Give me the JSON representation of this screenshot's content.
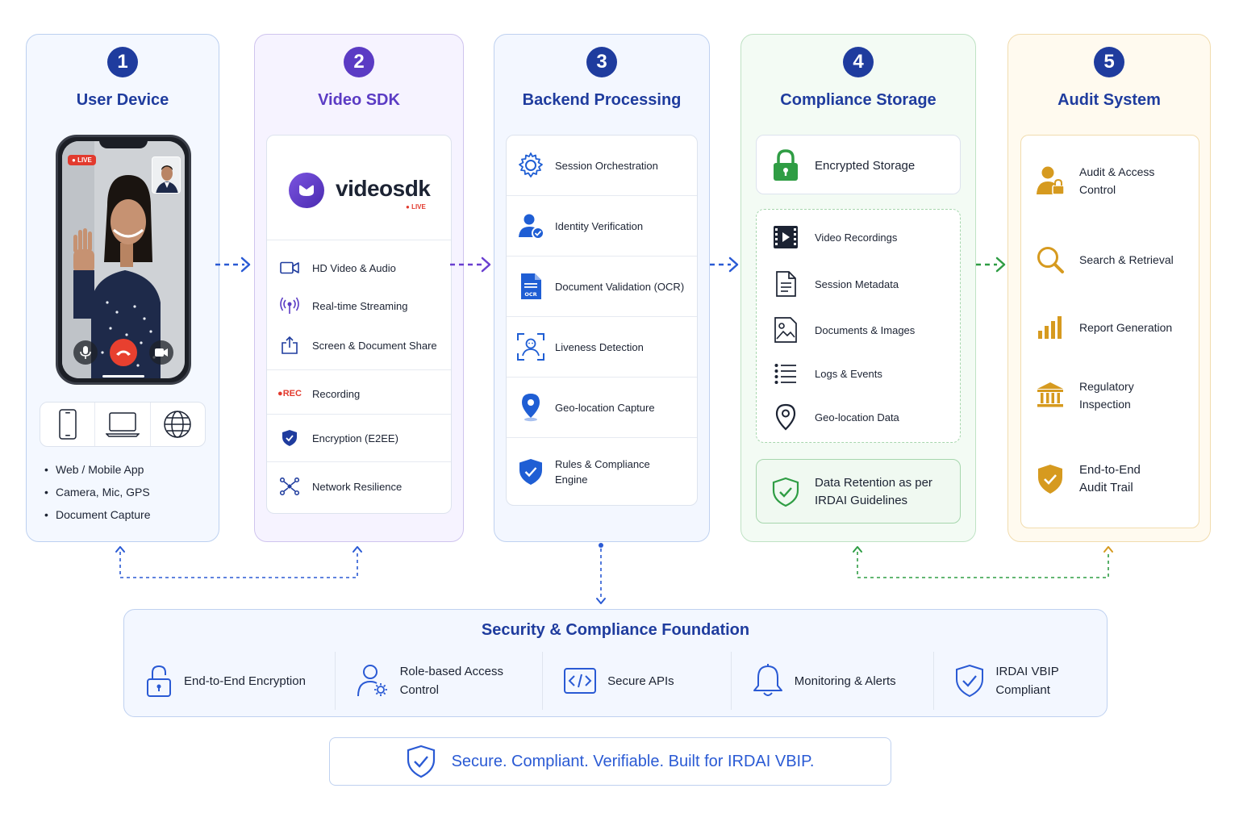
{
  "columns": [
    {
      "num": "1",
      "title": "User Device"
    },
    {
      "num": "2",
      "title": "Video SDK"
    },
    {
      "num": "3",
      "title": "Backend Processing"
    },
    {
      "num": "4",
      "title": "Compliance Storage"
    },
    {
      "num": "5",
      "title": "Audit System"
    }
  ],
  "device": {
    "live": "LIVE",
    "bullets": [
      "Web / Mobile App",
      "Camera, Mic, GPS",
      "Document Capture"
    ]
  },
  "sdk": {
    "brand": "videosdk",
    "brand_live": "LIVE",
    "features": [
      "HD Video & Audio",
      "Real-time Streaming",
      "Screen & Document Share"
    ],
    "rec_badge": "REC",
    "recording": "Recording",
    "encryption": "Encryption (E2EE)",
    "resilience": "Network Resilience"
  },
  "backend": {
    "items": [
      "Session Orchestration",
      "Identity Verification",
      "Document Validation (OCR)",
      "Liveness Detection",
      "Geo-location Capture",
      "Rules & Compliance Engine"
    ],
    "ocr_glyph": "OCR"
  },
  "storage": {
    "encrypted": "Encrypted Storage",
    "items": [
      "Video Recordings",
      "Session Metadata",
      "Documents & Images",
      "Logs & Events",
      "Geo-location Data"
    ],
    "retention": "Data Retention as per IRDAI Guidelines"
  },
  "audit": {
    "items": [
      "Audit & Access Control",
      "Search & Retrieval",
      "Report Generation",
      "Regulatory Inspection",
      "End-to-End Audit Trail"
    ]
  },
  "foundation": {
    "title": "Security & Compliance Foundation",
    "items": [
      "End-to-End Encryption",
      "Role-based Access Control",
      "Secure APIs",
      "Monitoring & Alerts",
      "IRDAI VBIP Compliant"
    ]
  },
  "tagline": "Secure. Compliant. Verifiable. Built for IRDAI VBIP.",
  "colors": {
    "navy": "#1f3c9e",
    "purple": "#5b3bc4",
    "green": "#2f9d44",
    "gold": "#d69a1f",
    "red": "#e23a2e"
  },
  "icons": [
    "phone-icon",
    "laptop-icon",
    "globe-icon",
    "video-icon",
    "broadcast-icon",
    "share-icon",
    "shield-icon",
    "network-icon",
    "gear-icon",
    "user-check-icon",
    "document-icon",
    "face-scan-icon",
    "map-pin-icon",
    "lock-icon",
    "film-icon",
    "file-icon",
    "image-icon",
    "list-icon",
    "search-icon",
    "bar-chart-icon",
    "bank-icon",
    "code-icon",
    "bell-icon"
  ]
}
